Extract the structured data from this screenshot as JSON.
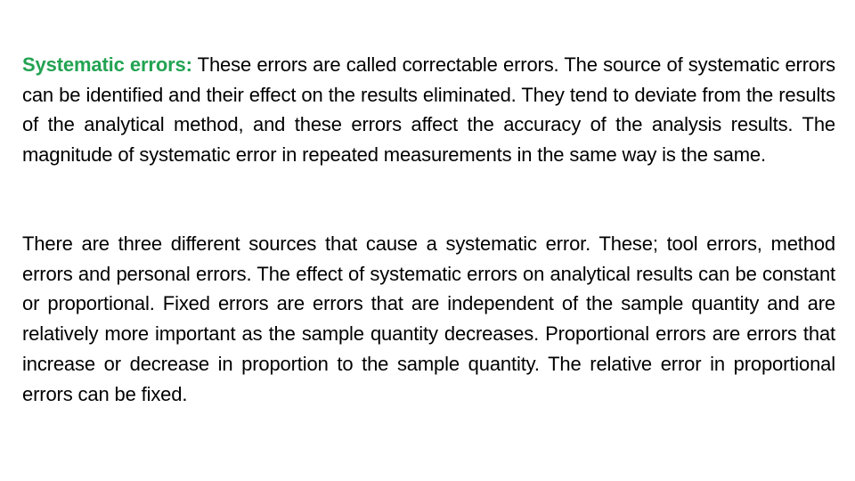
{
  "document": {
    "paragraphs": [
      {
        "term": "Systematic errors:",
        "text": " These errors are called correctable errors. The source of systematic errors can be identified and their effect on the results eliminated. They tend to deviate from the results of the analytical method, and these errors affect the accuracy of the analysis results. The magnitude of systematic error in repeated measurements in the same way is the same."
      },
      {
        "text": "There are three different sources that cause a systematic error. These; tool errors, method errors and personal errors. The effect of systematic errors on analytical results can be constant or proportional. Fixed errors are errors that are independent of the sample quantity and are relatively more important as the sample quantity decreases. Proportional errors are errors that increase or decrease in proportion to the sample quantity. The relative error in proportional errors can be fixed."
      }
    ]
  },
  "colors": {
    "term_highlight": "#22a352",
    "body_text": "#000000",
    "background": "#ffffff"
  }
}
